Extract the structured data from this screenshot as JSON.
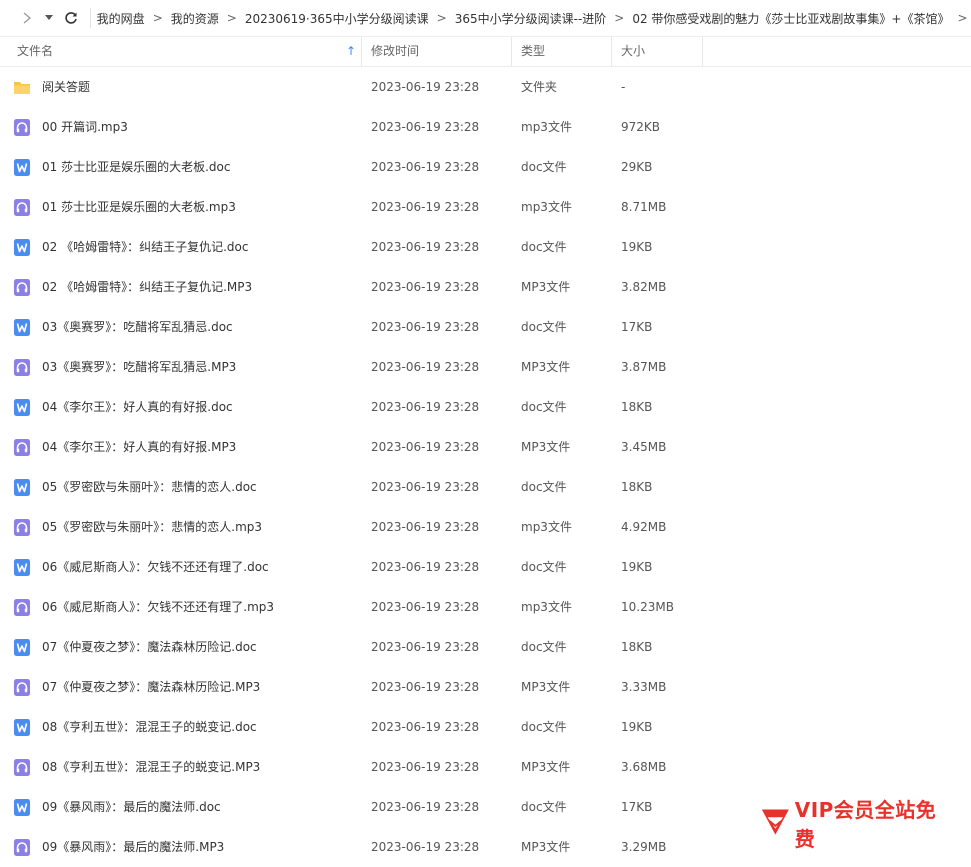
{
  "breadcrumb": [
    "我的网盘",
    "我的资源",
    "20230619·365中小学分级阅读课",
    "365中小学分级阅读课--进阶",
    "02 带你感受戏剧的魅力《莎士比亚戏剧故事集》+《茶馆》"
  ],
  "columns": {
    "name": "文件名",
    "time": "修改时间",
    "type": "类型",
    "size": "大小"
  },
  "files": [
    {
      "name": "阅关答题",
      "time": "2023-06-19 23:28",
      "type": "文件夹",
      "size": "-",
      "icon": "folder"
    },
    {
      "name": "00 开篇词.mp3",
      "time": "2023-06-19 23:28",
      "type": "mp3文件",
      "size": "972KB",
      "icon": "audio"
    },
    {
      "name": "01 莎士比亚是娱乐圈的大老板.doc",
      "time": "2023-06-19 23:28",
      "type": "doc文件",
      "size": "29KB",
      "icon": "word"
    },
    {
      "name": "01 莎士比亚是娱乐圈的大老板.mp3",
      "time": "2023-06-19 23:28",
      "type": "mp3文件",
      "size": "8.71MB",
      "icon": "audio"
    },
    {
      "name": "02 《哈姆雷特》：纠结王子复仇记.doc",
      "time": "2023-06-19 23:28",
      "type": "doc文件",
      "size": "19KB",
      "icon": "word"
    },
    {
      "name": "02 《哈姆雷特》：纠结王子复仇记.MP3",
      "time": "2023-06-19 23:28",
      "type": "MP3文件",
      "size": "3.82MB",
      "icon": "audio"
    },
    {
      "name": "03《奥赛罗》：吃醋将军乱猜忌.doc",
      "time": "2023-06-19 23:28",
      "type": "doc文件",
      "size": "17KB",
      "icon": "word"
    },
    {
      "name": "03《奥赛罗》：吃醋将军乱猜忌.MP3",
      "time": "2023-06-19 23:28",
      "type": "MP3文件",
      "size": "3.87MB",
      "icon": "audio"
    },
    {
      "name": "04《李尔王》：好人真的有好报.doc",
      "time": "2023-06-19 23:28",
      "type": "doc文件",
      "size": "18KB",
      "icon": "word"
    },
    {
      "name": "04《李尔王》：好人真的有好报.MP3",
      "time": "2023-06-19 23:28",
      "type": "MP3文件",
      "size": "3.45MB",
      "icon": "audio"
    },
    {
      "name": "05《罗密欧与朱丽叶》：悲情的恋人.doc",
      "time": "2023-06-19 23:28",
      "type": "doc文件",
      "size": "18KB",
      "icon": "word"
    },
    {
      "name": "05《罗密欧与朱丽叶》：悲情的恋人.mp3",
      "time": "2023-06-19 23:28",
      "type": "mp3文件",
      "size": "4.92MB",
      "icon": "audio"
    },
    {
      "name": "06《威尼斯商人》：欠钱不还还有理了.doc",
      "time": "2023-06-19 23:28",
      "type": "doc文件",
      "size": "19KB",
      "icon": "word"
    },
    {
      "name": "06《威尼斯商人》：欠钱不还还有理了.mp3",
      "time": "2023-06-19 23:28",
      "type": "mp3文件",
      "size": "10.23MB",
      "icon": "audio"
    },
    {
      "name": "07《仲夏夜之梦》：魔法森林历险记.doc",
      "time": "2023-06-19 23:28",
      "type": "doc文件",
      "size": "18KB",
      "icon": "word"
    },
    {
      "name": "07《仲夏夜之梦》：魔法森林历险记.MP3",
      "time": "2023-06-19 23:28",
      "type": "MP3文件",
      "size": "3.33MB",
      "icon": "audio"
    },
    {
      "name": "08《亨利五世》：混混王子的蜕变记.doc",
      "time": "2023-06-19 23:28",
      "type": "doc文件",
      "size": "19KB",
      "icon": "word"
    },
    {
      "name": "08《亨利五世》：混混王子的蜕变记.MP3",
      "time": "2023-06-19 23:28",
      "type": "MP3文件",
      "size": "3.68MB",
      "icon": "audio"
    },
    {
      "name": "09《暴风雨》：最后的魔法师.doc",
      "time": "2023-06-19 23:28",
      "type": "doc文件",
      "size": "17KB",
      "icon": "word"
    },
    {
      "name": "09《暴风雨》：最后的魔法师.MP3",
      "time": "2023-06-19 23:28",
      "type": "MP3文件",
      "size": "3.29MB",
      "icon": "audio"
    }
  ],
  "watermark": {
    "text": "VIP会员全站免费"
  },
  "colors": {
    "accent": "#3b8cf5",
    "folder": "#f8c54b",
    "word": "#4a8cf0",
    "audio": "#8b80e8",
    "watermark": "#e8312b"
  }
}
